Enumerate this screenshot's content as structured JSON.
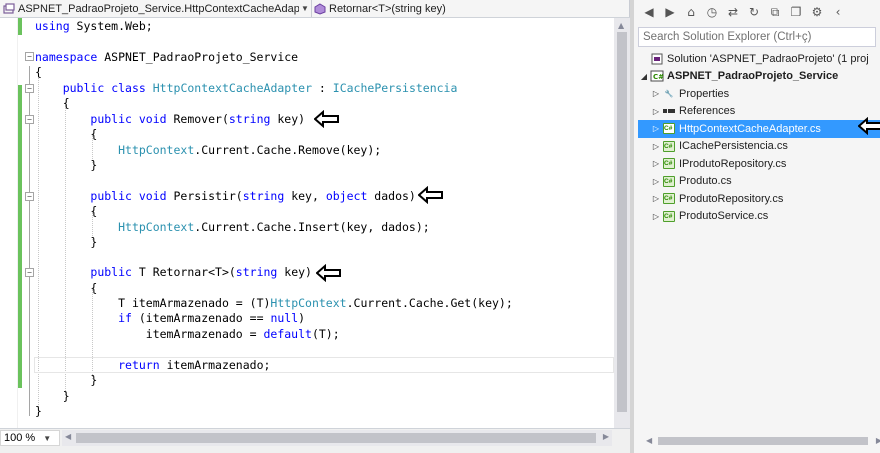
{
  "editor": {
    "nav_left": "ASPNET_PadraoProjeto_Service.HttpContextCacheAdapte",
    "nav_right": "Retornar<T>(string key)",
    "zoom": "100 %",
    "lines": {
      "l1_kw": "using",
      "l1_rest": " System.Web;",
      "l3_kw": "namespace",
      "l3_rest": " ASPNET_PadraoProjeto_Service",
      "brace_open": "{",
      "brace_close": "}",
      "l5_kw1": "public",
      "l5_kw2": "class",
      "l5_type": "HttpContextCacheAdapter",
      "l5_colon": " : ",
      "l5_iface": "ICachePersistencia",
      "m1_kw": "public void",
      "m1_name": " Remover(",
      "m1_kw2": "string",
      "m1_rest": " key)",
      "m1_body_type": "HttpContext",
      "m1_body_rest": ".Current.Cache.Remove(key);",
      "m2_kw": "public void",
      "m2_name": " Persistir(",
      "m2_kw2": "string",
      "m2_mid": " key, ",
      "m2_kw3": "object",
      "m2_rest": " dados)",
      "m2_body_type": "HttpContext",
      "m2_body_rest": ".Current.Cache.Insert(key, dados);",
      "m3_kw": "public",
      "m3_name": " T Retornar<T>(",
      "m3_kw2": "string",
      "m3_rest": " key)",
      "m3_l1_a": "T itemArmazenado = (T)",
      "m3_l1_type": "HttpContext",
      "m3_l1_rest": ".Current.Cache.Get(key);",
      "m3_l2_kw": "if",
      "m3_l2_mid": " (itemArmazenado == ",
      "m3_l2_kw2": "null",
      "m3_l2_end": ")",
      "m3_l3_a": "itemArmazenado = ",
      "m3_l3_kw": "default",
      "m3_l3_rest": "(T);",
      "m3_l4_kw": "return",
      "m3_l4_rest": " itemArmazenado;"
    }
  },
  "solution_explorer": {
    "search_placeholder": "Search Solution Explorer (Ctrl+ç)",
    "solution": "Solution 'ASPNET_PadraoProjeto' (1 proj",
    "project": "ASPNET_PadraoProjeto_Service",
    "items": [
      {
        "label": "Properties",
        "icon": "wrench-icon"
      },
      {
        "label": "References",
        "icon": "references-icon"
      },
      {
        "label": "HttpContextCacheAdapter.cs",
        "icon": "cs-file-icon",
        "selected": true
      },
      {
        "label": "ICachePersistencia.cs",
        "icon": "cs-file-icon"
      },
      {
        "label": "IProdutoRepository.cs",
        "icon": "cs-file-icon"
      },
      {
        "label": "Produto.cs",
        "icon": "cs-file-icon"
      },
      {
        "label": "ProdutoRepository.cs",
        "icon": "cs-file-icon"
      },
      {
        "label": "ProdutoService.cs",
        "icon": "cs-file-icon"
      }
    ],
    "cs_badge": "C#",
    "selection_color": "#3399ff"
  }
}
